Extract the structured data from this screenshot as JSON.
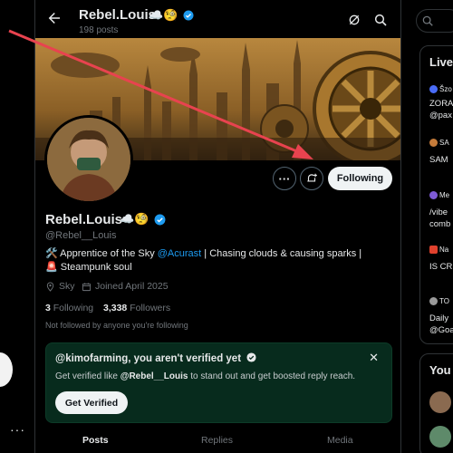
{
  "top": {
    "name": "Rebel.Louis",
    "emoji": "☁️🧐",
    "posts": "198 posts"
  },
  "profile": {
    "name": "Rebel.Louis",
    "emoji": "☁️🧐",
    "handle": "@Rebel__Louis",
    "bio_prefix": "🛠️ Apprentice of the Sky ",
    "bio_link": "@Acurast",
    "bio_suffix": " | Chasing clouds & causing sparks | 🚨 Steampunk soul",
    "location": "Sky",
    "joined": "Joined April 2025",
    "following_count": "3",
    "following_label": "Following",
    "followers_count": "3,338",
    "followers_label": "Followers",
    "not_followed": "Not followed by anyone you're following"
  },
  "buttons": {
    "more": "···",
    "following": "Following"
  },
  "verify": {
    "title": "@kimofarming, you aren't verified yet",
    "sub_prefix": "Get verified like ",
    "sub_handle": "@Rebel__Louis",
    "sub_suffix": " to stand out and get boosted reply reach.",
    "close": "✕",
    "button": "Get Verified"
  },
  "tabs": [
    "Posts",
    "Replies",
    "Media"
  ],
  "right": {
    "live_title": "Live",
    "live_items": [
      {
        "label": "Šzo",
        "text": "ZORA",
        "text2": "@pax"
      },
      {
        "label": "SA",
        "text": "SAM"
      },
      {
        "label": "Me",
        "text": "/vibe",
        "text2": "comb"
      },
      {
        "label": "Na",
        "text": "IS CR"
      },
      {
        "label": "TO",
        "text": "Daily",
        "text2": "@Goa"
      }
    ],
    "you_title": "You"
  },
  "left": {
    "more": "···"
  },
  "colors": {
    "accent": "#1d9bf0",
    "verify_bg": "#072b1d",
    "arrow": "#e8434f"
  }
}
